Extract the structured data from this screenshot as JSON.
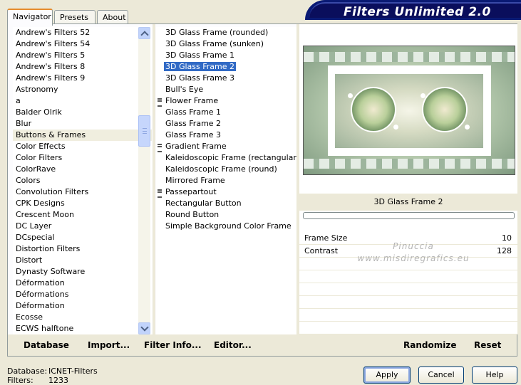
{
  "app": {
    "title": "Filters Unlimited 2.0"
  },
  "tabs": [
    {
      "label": "Navigator",
      "active": true
    },
    {
      "label": "Presets",
      "active": false
    },
    {
      "label": "About",
      "active": false
    }
  ],
  "categories": {
    "selected": "Buttons & Frames",
    "items": [
      "Andrew's Filters 52",
      "Andrew's Filters 54",
      "Andrew's Filters 5",
      "Andrew's Filters 8",
      "Andrew's Filters 9",
      "Astronomy",
      "a",
      "Balder Olrik",
      "Blur",
      "Buttons & Frames",
      "Color Effects",
      "Color Filters",
      "ColorRave",
      "Colors",
      "Convolution Filters",
      "CPK Designs",
      "Crescent Moon",
      "DC Layer",
      "DCspecial",
      "Distortion Filters",
      "Distort",
      "Dynasty Software",
      "Déformation",
      "Déformations",
      "Déformation",
      "Ecosse",
      "ECWS halftone"
    ]
  },
  "filters": {
    "selected": "3D Glass Frame 2",
    "items": [
      {
        "label": "3D Glass Frame (rounded)",
        "group": false
      },
      {
        "label": "3D Glass Frame (sunken)",
        "group": false
      },
      {
        "label": "3D Glass Frame 1",
        "group": false
      },
      {
        "label": "3D Glass Frame 2",
        "group": false
      },
      {
        "label": "3D Glass Frame 3",
        "group": false
      },
      {
        "label": "Bull's Eye",
        "group": false
      },
      {
        "label": "Flower Frame",
        "group": true
      },
      {
        "label": "Glass Frame 1",
        "group": false
      },
      {
        "label": "Glass Frame 2",
        "group": false
      },
      {
        "label": "Glass Frame 3",
        "group": false
      },
      {
        "label": "Gradient Frame",
        "group": true
      },
      {
        "label": "Kaleidoscopic Frame (rectangular)",
        "group": false
      },
      {
        "label": "Kaleidoscopic Frame (round)",
        "group": false
      },
      {
        "label": "Mirrored Frame",
        "group": false
      },
      {
        "label": "Passepartout",
        "group": true
      },
      {
        "label": "Rectangular Button",
        "group": false
      },
      {
        "label": "Round Button",
        "group": false
      },
      {
        "label": "Simple Background Color Frame",
        "group": false
      }
    ]
  },
  "preview": {
    "filter_name": "3D Glass Frame 2",
    "watermark_line1": "Pinuccia",
    "watermark_line2": "www.misdiregrafics.eu"
  },
  "params": [
    {
      "label": "Frame Size",
      "value": "10"
    },
    {
      "label": "Contrast",
      "value": "128"
    }
  ],
  "actions": {
    "database": "Database",
    "import": "Import...",
    "filter_info": "Filter Info...",
    "editor": "Editor...",
    "randomize": "Randomize",
    "reset": "Reset"
  },
  "footer": {
    "database_label": "Database:",
    "database_value": "ICNET-Filters",
    "filters_label": "Filters:",
    "filters_value": "1233",
    "apply": "Apply",
    "cancel": "Cancel",
    "help": "Help"
  },
  "colors": {
    "selection": "#316ac5",
    "banner": "#0a1a74",
    "tab_accent": "#e68b2c",
    "dialog_bg": "#ece9d8"
  }
}
